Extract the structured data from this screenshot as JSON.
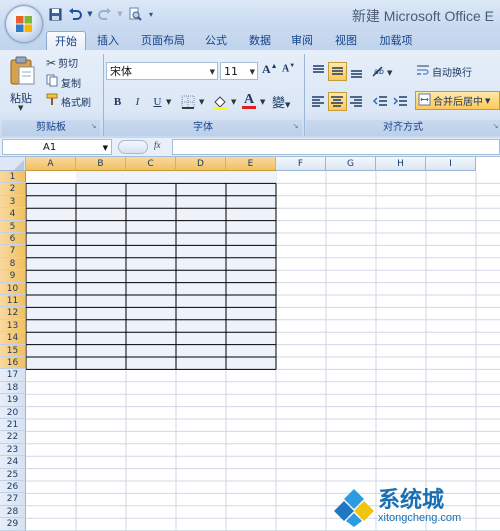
{
  "window": {
    "title": "新建 Microsoft Office E"
  },
  "tabs": [
    {
      "label": "开始",
      "active": true
    },
    {
      "label": "插入",
      "active": false
    },
    {
      "label": "页面布局",
      "active": false
    },
    {
      "label": "公式",
      "active": false
    },
    {
      "label": "数据",
      "active": false
    },
    {
      "label": "审阅",
      "active": false
    },
    {
      "label": "视图",
      "active": false
    },
    {
      "label": "加载项",
      "active": false
    }
  ],
  "clipboard": {
    "group_label": "剪贴板",
    "paste_label": "粘贴",
    "cut_label": "剪切",
    "copy_label": "复制",
    "format_painter_label": "格式刷"
  },
  "font": {
    "group_label": "字体",
    "font_name": "宋体",
    "font_size": "11",
    "bold": "B",
    "italic": "I",
    "underline": "U",
    "font_color_letter": "A",
    "phonetic_label": "變"
  },
  "alignment": {
    "group_label": "对齐方式",
    "wrap_text_label": "自动换行",
    "merge_center_label": "合并后居中"
  },
  "formula_bar": {
    "name_box": "A1",
    "fx": "fx"
  },
  "columns": [
    "A",
    "B",
    "C",
    "D",
    "E",
    "F",
    "G",
    "H",
    "I"
  ],
  "rows": [
    "1",
    "2",
    "3",
    "4",
    "5",
    "6",
    "7",
    "8",
    "9",
    "10",
    "11",
    "12",
    "13",
    "14",
    "15",
    "16",
    "17",
    "18",
    "19",
    "20",
    "21",
    "22",
    "23",
    "24",
    "25",
    "26",
    "27",
    "28",
    "29"
  ],
  "selected_columns": [
    "A",
    "B",
    "C",
    "D",
    "E"
  ],
  "selected_rows": [
    "1",
    "2",
    "3",
    "4",
    "5",
    "6",
    "7",
    "8",
    "9",
    "10",
    "11",
    "12",
    "13",
    "14",
    "15",
    "16"
  ],
  "watermark": {
    "brand": "系统城",
    "url": "xitongcheng.com"
  },
  "colors": {
    "ribbon": "#dbe7f6",
    "tab_text": "#15428b",
    "selection": "#f1c15f",
    "grid_line": "#d0d7e5",
    "border": "#000000"
  }
}
